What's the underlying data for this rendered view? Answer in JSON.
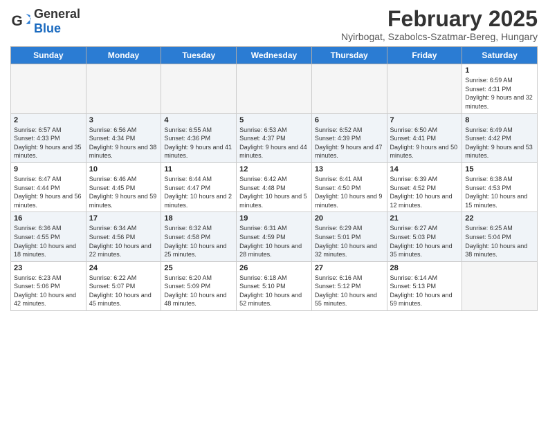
{
  "header": {
    "logo_general": "General",
    "logo_blue": "Blue",
    "title": "February 2025",
    "location": "Nyirbogat, Szabolcs-Szatmar-Bereg, Hungary"
  },
  "days_of_week": [
    "Sunday",
    "Monday",
    "Tuesday",
    "Wednesday",
    "Thursday",
    "Friday",
    "Saturday"
  ],
  "weeks": [
    [
      {
        "day": "",
        "info": "",
        "empty": true
      },
      {
        "day": "",
        "info": "",
        "empty": true
      },
      {
        "day": "",
        "info": "",
        "empty": true
      },
      {
        "day": "",
        "info": "",
        "empty": true
      },
      {
        "day": "",
        "info": "",
        "empty": true
      },
      {
        "day": "",
        "info": "",
        "empty": true
      },
      {
        "day": "1",
        "info": "Sunrise: 6:59 AM\nSunset: 4:31 PM\nDaylight: 9 hours and 32 minutes."
      }
    ],
    [
      {
        "day": "2",
        "info": "Sunrise: 6:57 AM\nSunset: 4:33 PM\nDaylight: 9 hours and 35 minutes."
      },
      {
        "day": "3",
        "info": "Sunrise: 6:56 AM\nSunset: 4:34 PM\nDaylight: 9 hours and 38 minutes."
      },
      {
        "day": "4",
        "info": "Sunrise: 6:55 AM\nSunset: 4:36 PM\nDaylight: 9 hours and 41 minutes."
      },
      {
        "day": "5",
        "info": "Sunrise: 6:53 AM\nSunset: 4:37 PM\nDaylight: 9 hours and 44 minutes."
      },
      {
        "day": "6",
        "info": "Sunrise: 6:52 AM\nSunset: 4:39 PM\nDaylight: 9 hours and 47 minutes."
      },
      {
        "day": "7",
        "info": "Sunrise: 6:50 AM\nSunset: 4:41 PM\nDaylight: 9 hours and 50 minutes."
      },
      {
        "day": "8",
        "info": "Sunrise: 6:49 AM\nSunset: 4:42 PM\nDaylight: 9 hours and 53 minutes."
      }
    ],
    [
      {
        "day": "9",
        "info": "Sunrise: 6:47 AM\nSunset: 4:44 PM\nDaylight: 9 hours and 56 minutes."
      },
      {
        "day": "10",
        "info": "Sunrise: 6:46 AM\nSunset: 4:45 PM\nDaylight: 9 hours and 59 minutes."
      },
      {
        "day": "11",
        "info": "Sunrise: 6:44 AM\nSunset: 4:47 PM\nDaylight: 10 hours and 2 minutes."
      },
      {
        "day": "12",
        "info": "Sunrise: 6:42 AM\nSunset: 4:48 PM\nDaylight: 10 hours and 5 minutes."
      },
      {
        "day": "13",
        "info": "Sunrise: 6:41 AM\nSunset: 4:50 PM\nDaylight: 10 hours and 9 minutes."
      },
      {
        "day": "14",
        "info": "Sunrise: 6:39 AM\nSunset: 4:52 PM\nDaylight: 10 hours and 12 minutes."
      },
      {
        "day": "15",
        "info": "Sunrise: 6:38 AM\nSunset: 4:53 PM\nDaylight: 10 hours and 15 minutes."
      }
    ],
    [
      {
        "day": "16",
        "info": "Sunrise: 6:36 AM\nSunset: 4:55 PM\nDaylight: 10 hours and 18 minutes."
      },
      {
        "day": "17",
        "info": "Sunrise: 6:34 AM\nSunset: 4:56 PM\nDaylight: 10 hours and 22 minutes."
      },
      {
        "day": "18",
        "info": "Sunrise: 6:32 AM\nSunset: 4:58 PM\nDaylight: 10 hours and 25 minutes."
      },
      {
        "day": "19",
        "info": "Sunrise: 6:31 AM\nSunset: 4:59 PM\nDaylight: 10 hours and 28 minutes."
      },
      {
        "day": "20",
        "info": "Sunrise: 6:29 AM\nSunset: 5:01 PM\nDaylight: 10 hours and 32 minutes."
      },
      {
        "day": "21",
        "info": "Sunrise: 6:27 AM\nSunset: 5:03 PM\nDaylight: 10 hours and 35 minutes."
      },
      {
        "day": "22",
        "info": "Sunrise: 6:25 AM\nSunset: 5:04 PM\nDaylight: 10 hours and 38 minutes."
      }
    ],
    [
      {
        "day": "23",
        "info": "Sunrise: 6:23 AM\nSunset: 5:06 PM\nDaylight: 10 hours and 42 minutes."
      },
      {
        "day": "24",
        "info": "Sunrise: 6:22 AM\nSunset: 5:07 PM\nDaylight: 10 hours and 45 minutes."
      },
      {
        "day": "25",
        "info": "Sunrise: 6:20 AM\nSunset: 5:09 PM\nDaylight: 10 hours and 48 minutes."
      },
      {
        "day": "26",
        "info": "Sunrise: 6:18 AM\nSunset: 5:10 PM\nDaylight: 10 hours and 52 minutes."
      },
      {
        "day": "27",
        "info": "Sunrise: 6:16 AM\nSunset: 5:12 PM\nDaylight: 10 hours and 55 minutes."
      },
      {
        "day": "28",
        "info": "Sunrise: 6:14 AM\nSunset: 5:13 PM\nDaylight: 10 hours and 59 minutes."
      },
      {
        "day": "",
        "info": "",
        "empty": true
      }
    ]
  ]
}
